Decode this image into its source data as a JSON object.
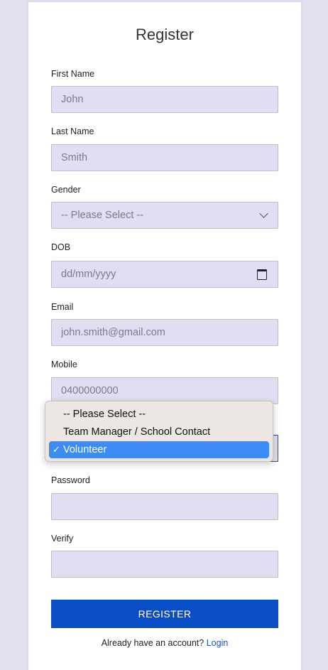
{
  "form": {
    "title": "Register",
    "first_name": {
      "label": "First Name",
      "placeholder": "John"
    },
    "last_name": {
      "label": "Last Name",
      "placeholder": "Smith"
    },
    "gender": {
      "label": "Gender",
      "selected": "-- Please Select --"
    },
    "dob": {
      "label": "DOB",
      "placeholder": "dd/mm/yyyy"
    },
    "email": {
      "label": "Email",
      "placeholder": "john.smith@gmail.com"
    },
    "mobile": {
      "label": "Mobile",
      "placeholder": "0400000000"
    },
    "role": {
      "options": [
        "-- Please Select --",
        "Team Manager / School Contact",
        "Volunteer"
      ],
      "selected_index": 2,
      "check_mark": "✓"
    },
    "password": {
      "label": "Password",
      "value": ""
    },
    "verify": {
      "label": "Verify",
      "value": ""
    },
    "submit_label": "REGISTER",
    "footer_text": "Already have an account?",
    "login_link": "Login"
  },
  "colors": {
    "background": "#e0e0f0",
    "field_fill": "#dfdff1",
    "button": "#0b4dc4",
    "link": "#1c4fbf",
    "menu_highlight": "#3d8cf5"
  }
}
